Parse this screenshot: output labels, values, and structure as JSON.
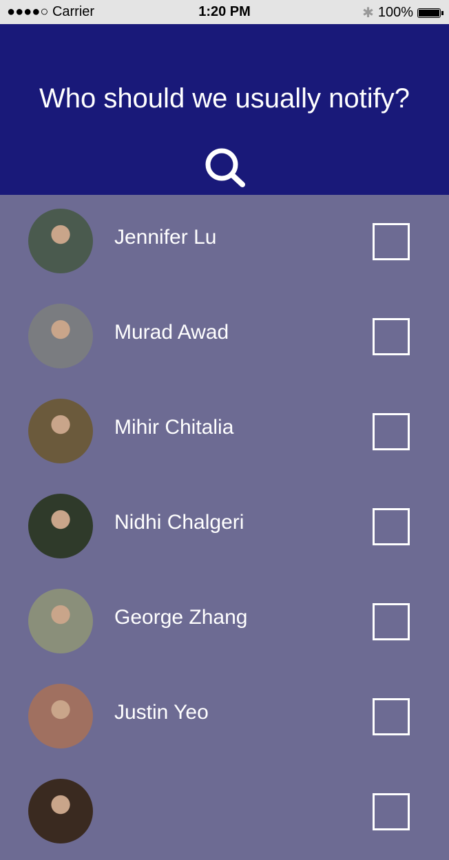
{
  "status_bar": {
    "carrier": "●●●●○ Carrier",
    "time": "1:20 PM",
    "battery": "100%"
  },
  "header": {
    "title": "Who should we usually notify?",
    "search_icon": "search-icon"
  },
  "contacts": [
    {
      "name": "Jennifer Lu",
      "checked": false,
      "avatar_color": "#4a5a4e"
    },
    {
      "name": "Murad Awad",
      "checked": false,
      "avatar_color": "#7a7c80"
    },
    {
      "name": "Mihir Chitalia",
      "checked": false,
      "avatar_color": "#6b5a3c"
    },
    {
      "name": "Nidhi Chalgeri",
      "checked": false,
      "avatar_color": "#2f3a2a"
    },
    {
      "name": "George Zhang",
      "checked": false,
      "avatar_color": "#8a8f7a"
    },
    {
      "name": "Justin Yeo",
      "checked": false,
      "avatar_color": "#a07060"
    },
    {
      "checked": false,
      "avatar_color": "#3a2a20"
    }
  ]
}
